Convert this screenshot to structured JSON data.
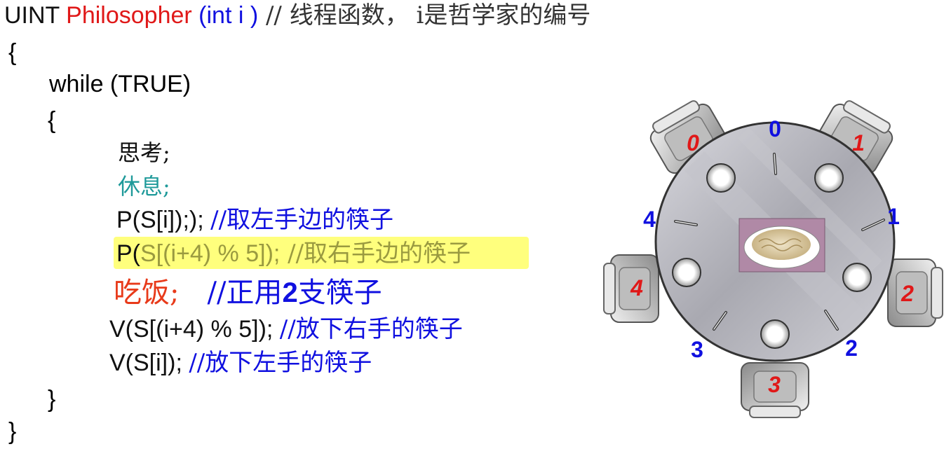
{
  "code": {
    "header": {
      "kw": "UINT ",
      "fname": "Philosopher",
      "params": " (int i )",
      "comment": " // 线程函数，  i是哲学家的编号"
    },
    "brace_open_outer": "{",
    "while_line": "while (TRUE)",
    "brace_open_inner": "{",
    "think": "思考;",
    "rest": "休息;",
    "p_left": {
      "code": "P(S[i]);); ",
      "comment": "//取左手边的筷子"
    },
    "p_right": {
      "code_dark": "P(",
      "code_light": "S[(i+4) % 5]);",
      "comment": "  //取右手边的筷子"
    },
    "eat": {
      "action": "吃饭;",
      "comment_a": "//正用",
      "num": "2",
      "comment_b": "支筷子"
    },
    "v_right": {
      "code": "V(S[(i+4) % 5]);  ",
      "comment": "//放下右手的筷子"
    },
    "v_left": {
      "code": "V(S[i]); ",
      "comment": "//放下左手的筷子"
    },
    "brace_close_inner": "}",
    "brace_close_outer": "}"
  },
  "table": {
    "seats": [
      "0",
      "1",
      "2",
      "3",
      "4"
    ],
    "chopsticks": [
      "0",
      "1",
      "2",
      "3",
      "4"
    ],
    "colors": {
      "seat_label": "#e01818",
      "chopstick_label": "#1010e0",
      "table_fill": "#b8b8c0"
    }
  }
}
